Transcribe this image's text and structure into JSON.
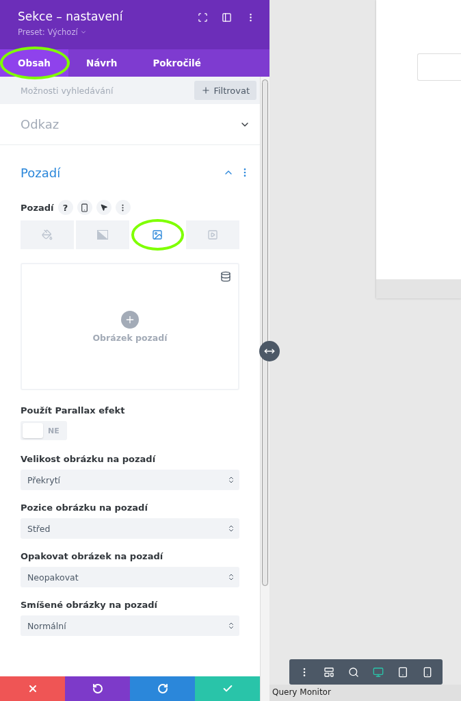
{
  "panel": {
    "title": "Sekce – nastavení",
    "preset": "Preset: Výchozí",
    "tabs": [
      {
        "label": "Obsah",
        "selected": true,
        "highlighted": true
      },
      {
        "label": "Návrh",
        "selected": false,
        "highlighted": false
      },
      {
        "label": "Pokročilé",
        "selected": false,
        "highlighted": false
      }
    ],
    "search": {
      "placeholder": "Možnosti vyhledávání",
      "filter_button": "Filtrovat"
    },
    "sections": [
      {
        "title": "Odkaz",
        "expanded": false
      },
      {
        "title": "Pozadí",
        "expanded": true
      }
    ],
    "background": {
      "label": "Pozadí",
      "help": "?",
      "type_tabs": [
        {
          "kind": "color",
          "selected": false,
          "highlighted": false
        },
        {
          "kind": "gradient",
          "selected": false,
          "highlighted": false
        },
        {
          "kind": "image",
          "selected": true,
          "highlighted": true
        },
        {
          "kind": "video",
          "selected": false,
          "highlighted": false
        }
      ],
      "image_upload": "Obrázek pozadí"
    },
    "settings": [
      {
        "kind": "toggle",
        "label": "Použít Parallax efekt",
        "on": false,
        "value": "NE"
      },
      {
        "kind": "select",
        "label": "Velikost obrázku na pozadí",
        "value": "Překrytí"
      },
      {
        "kind": "select",
        "label": "Pozice obrázku na pozadí",
        "value": "Střed"
      },
      {
        "kind": "select",
        "label": "Opakovat obrázek na pozadí",
        "value": "Neopakovat"
      },
      {
        "kind": "select",
        "label": "Smíšené obrázky na pozadí",
        "value": "Normální"
      }
    ],
    "actions": [
      {
        "kind": "discard"
      },
      {
        "kind": "undo"
      },
      {
        "kind": "redo"
      },
      {
        "kind": "save"
      }
    ]
  },
  "preview": {
    "toolbar": [
      {
        "kind": "menu",
        "selected": false
      },
      {
        "kind": "layout",
        "selected": false
      },
      {
        "kind": "zoom",
        "selected": false
      },
      {
        "kind": "desktop",
        "selected": true
      },
      {
        "kind": "tablet",
        "selected": false
      },
      {
        "kind": "phone",
        "selected": false
      }
    ],
    "status": "Query Monitor"
  }
}
